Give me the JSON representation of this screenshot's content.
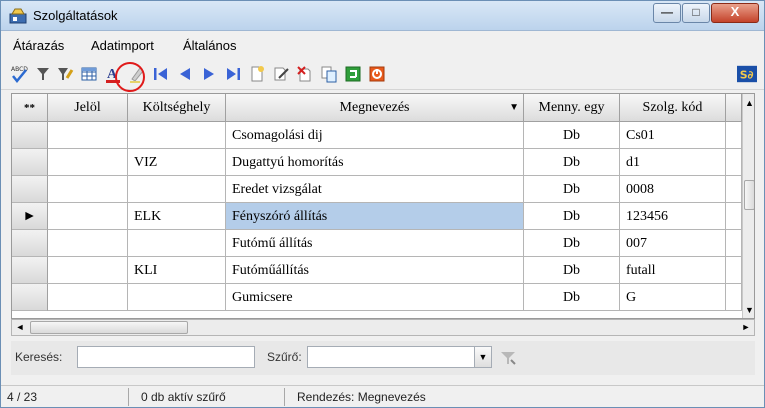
{
  "window": {
    "title": "Szolgáltatások",
    "min_glyph": "—",
    "max_glyph": "□",
    "close_glyph": "X"
  },
  "menu": [
    {
      "label": "Átárazás"
    },
    {
      "label": "Adatimport"
    },
    {
      "label": "Általános"
    }
  ],
  "toolbar": {
    "icons": [
      "spellcheck-icon",
      "filter-icon",
      "filter-clear-icon",
      "grid-layout-icon",
      "font-color-icon",
      "highlighter-icon",
      "first-record-icon",
      "previous-record-icon",
      "next-record-icon",
      "last-record-icon",
      "new-record-icon",
      "edit-record-icon",
      "delete-record-icon",
      "copy-record-icon",
      "refresh-icon",
      "stop-icon"
    ],
    "logo_text": "S∂"
  },
  "grid": {
    "columns": [
      {
        "label": "**"
      },
      {
        "label": "Jelöl"
      },
      {
        "label": "Költséghely"
      },
      {
        "label": "Megnevezés",
        "sort_glyph": "▼"
      },
      {
        "label": "Menny. egy"
      },
      {
        "label": "Szolg. kód"
      }
    ],
    "rows": [
      {
        "marker": "",
        "jelol": "",
        "koltseghely": "",
        "megnevezes": "Csomagolási dij",
        "menny": "Db",
        "kod": "Cs01"
      },
      {
        "marker": "",
        "jelol": "",
        "koltseghely": "VIZ",
        "megnevezes": "Dugattyú homorítás",
        "menny": "Db",
        "kod": "d1"
      },
      {
        "marker": "",
        "jelol": "",
        "koltseghely": "",
        "megnevezes": "Eredet vizsgálat",
        "menny": "Db",
        "kod": "0008"
      },
      {
        "marker": "►",
        "jelol": "",
        "koltseghely": "ELK",
        "megnevezes": "Fényszóró állítás",
        "menny": "Db",
        "kod": "123456",
        "selected": true
      },
      {
        "marker": "",
        "jelol": "",
        "koltseghely": "",
        "megnevezes": "Futómű állítás",
        "menny": "Db",
        "kod": "007"
      },
      {
        "marker": "",
        "jelol": "",
        "koltseghely": "KLI",
        "megnevezes": "Futóműállítás",
        "menny": "Db",
        "kod": "futall"
      },
      {
        "marker": "",
        "jelol": "",
        "koltseghely": "",
        "megnevezes": "Gumicsere",
        "menny": "Db",
        "kod": "G"
      }
    ]
  },
  "search": {
    "search_label": "Keresés:",
    "search_value": "",
    "filter_label": "Szűrő:",
    "filter_value": ""
  },
  "status": {
    "position": "4 / 23",
    "filters": "0 db aktív szűrő",
    "sort": "Rendezés: Megnevezés"
  },
  "colors": {
    "highlight": "#e01a1a",
    "selection": "#b4cde9"
  }
}
